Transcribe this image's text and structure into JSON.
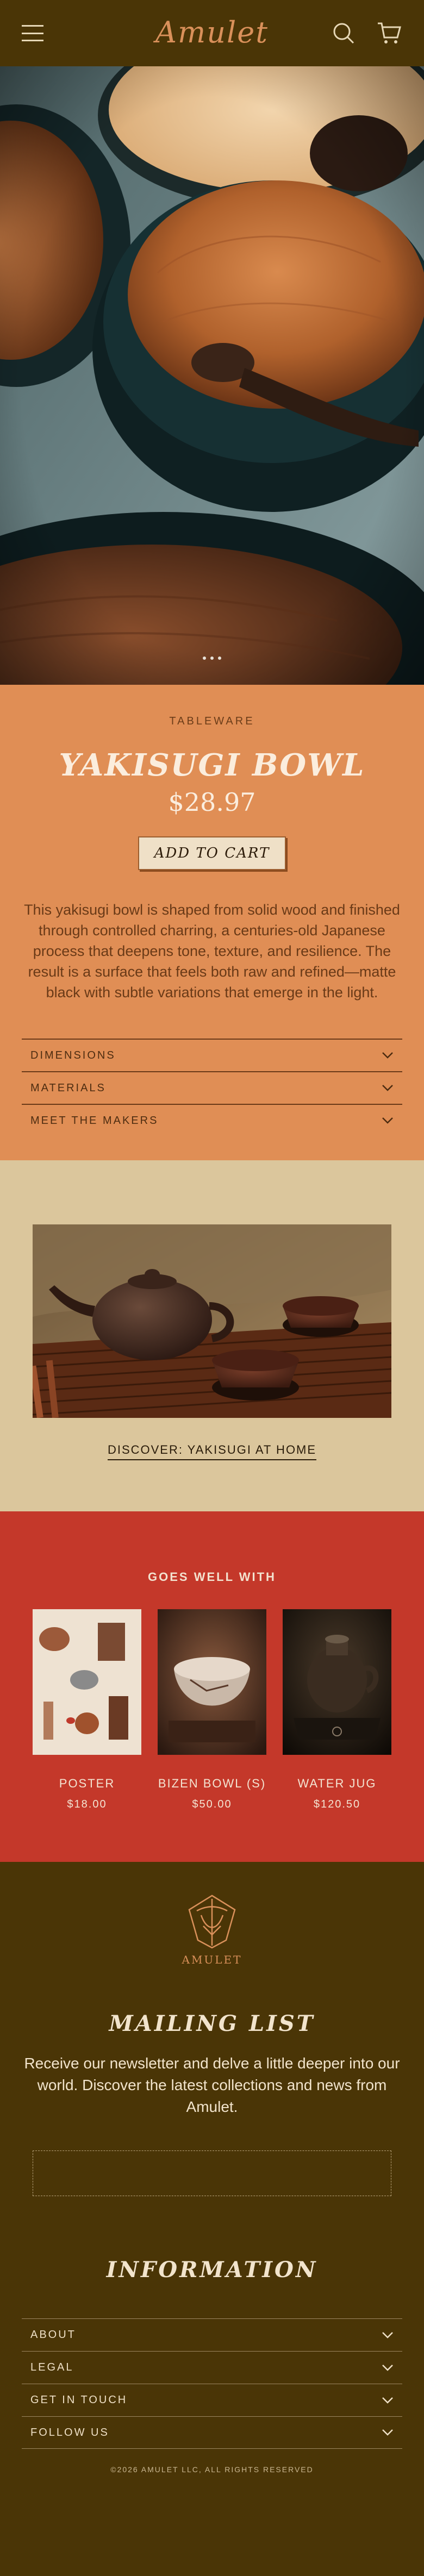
{
  "header": {
    "logo": "Amulet",
    "menu_icon": "hamburger-menu-icon",
    "search_icon": "search-icon",
    "cart_icon": "shopping-cart-icon"
  },
  "hero": {
    "image": "wooden bowls and spoon photo",
    "dots_icon": "ellipsis-icon"
  },
  "product": {
    "category": "TABLEWARE",
    "title": "YAKISUGI BOWL",
    "price": "$28.97",
    "add_to_cart": "ADD TO CART",
    "description": "This yakisugi bowl is shaped from solid wood and finished through controlled charring, a centuries-old Japanese process that deepens tone, texture, and resilience. The result is a surface that feels both raw and refined—matte black with subtle variations that emerge in the light.",
    "accordion": [
      {
        "label": "DIMENSIONS"
      },
      {
        "label": "MATERIALS"
      },
      {
        "label": "MEET THE MAKERS"
      }
    ]
  },
  "feature": {
    "image": "teapot and cups on bamboo mat photo",
    "link": "DISCOVER: YAKISUGI AT HOME"
  },
  "goes_well": {
    "title": "GOES WELL WITH",
    "items": [
      {
        "name": "POSTER",
        "price": "$18.00"
      },
      {
        "name": "BIZEN BOWL (S)",
        "price": "$50.00"
      },
      {
        "name": "WATER JUG",
        "price": "$120.50"
      }
    ]
  },
  "footer": {
    "logo_text": "AMULET",
    "newsletter_heading": "MAILING LIST",
    "newsletter_text": "Receive our newsletter and delve a little deeper into our world. Discover the latest collections and news from Amulet.",
    "newsletter_placeholder": "",
    "info_heading": "INFORMATION",
    "info_items": [
      {
        "label": "ABOUT"
      },
      {
        "label": "LEGAL"
      },
      {
        "label": "GET IN TOUCH"
      },
      {
        "label": "FOLLOW US"
      }
    ],
    "copyright": "©2026 AMULET LLC, ALL RIGHTS RESERVED"
  },
  "colors": {
    "header_bg": "#4a3506",
    "product_bg": "#e08e55",
    "feature_bg": "#dbc69c",
    "goes_bg": "#c4382a",
    "accent": "#d9905a"
  }
}
